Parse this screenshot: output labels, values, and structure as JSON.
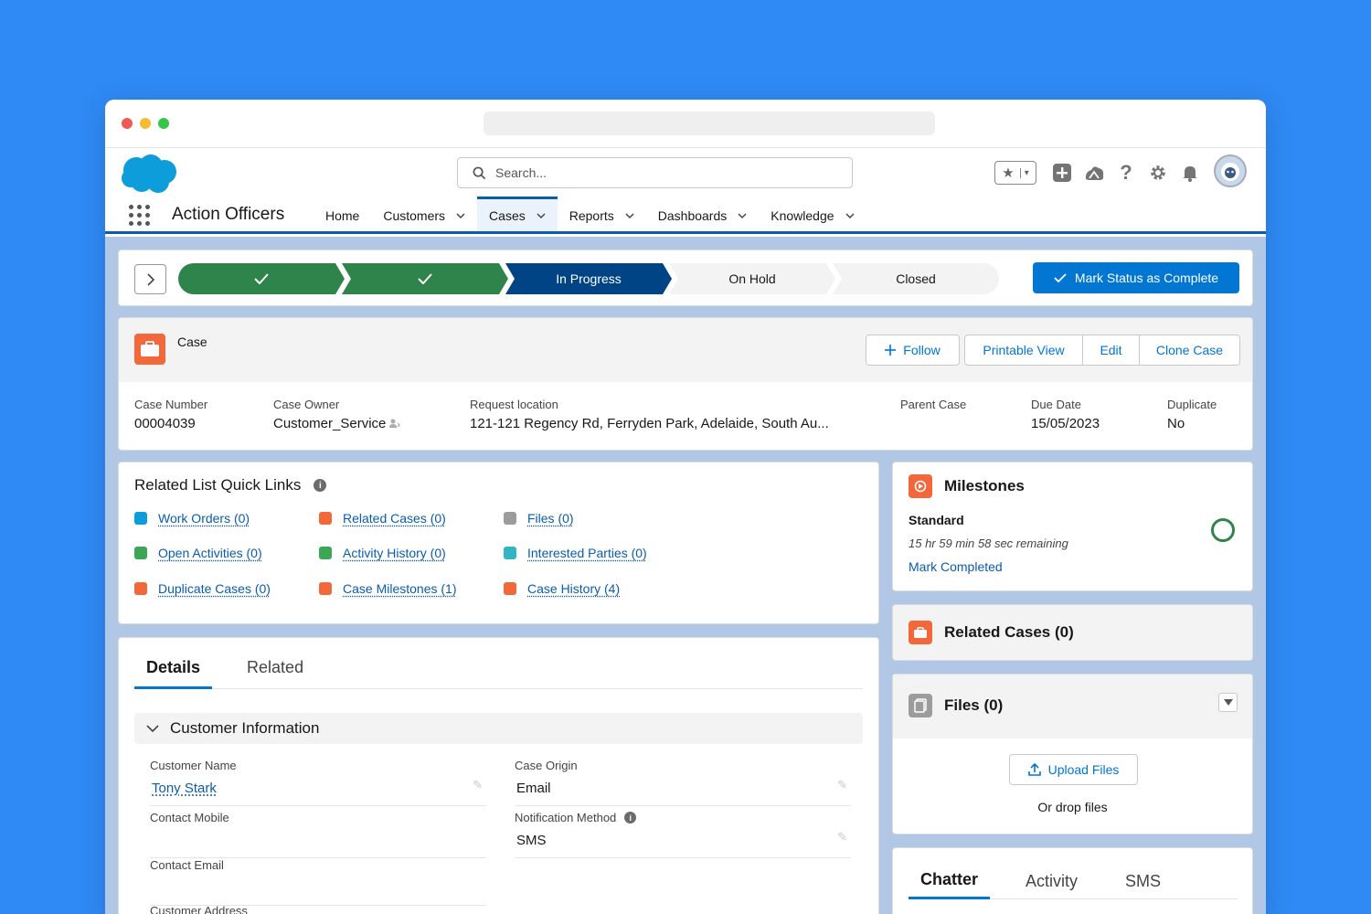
{
  "app": {
    "name": "Action Officers"
  },
  "search": {
    "placeholder": "Search..."
  },
  "nav": [
    {
      "label": "Home",
      "dropdown": false,
      "active": false
    },
    {
      "label": "Customers",
      "dropdown": true,
      "active": false
    },
    {
      "label": "Cases",
      "dropdown": true,
      "active": true
    },
    {
      "label": "Reports",
      "dropdown": true,
      "active": false
    },
    {
      "label": "Dashboards",
      "dropdown": true,
      "active": false
    },
    {
      "label": "Knowledge",
      "dropdown": true,
      "active": false
    }
  ],
  "path": {
    "stages": [
      {
        "label": "",
        "status": "done"
      },
      {
        "label": "",
        "status": "done"
      },
      {
        "label": "In Progress",
        "status": "current"
      },
      {
        "label": "On Hold",
        "status": "todo"
      },
      {
        "label": "Closed",
        "status": "todo"
      }
    ],
    "mark_button": "Mark Status as Complete"
  },
  "case": {
    "object_label": "Case",
    "buttons": {
      "follow": "Follow",
      "printable": "Printable View",
      "edit": "Edit",
      "clone": "Clone Case"
    },
    "fields": [
      {
        "label": "Case Number",
        "value": "00004039"
      },
      {
        "label": "Case Owner",
        "value": "Customer_Service"
      },
      {
        "label": "Request location",
        "value": "121-121 Regency Rd, Ferryden Park, Adelaide, South Au..."
      },
      {
        "label": "Parent Case",
        "value": ""
      },
      {
        "label": "Due Date",
        "value": "15/05/2023"
      },
      {
        "label": "Duplicate",
        "value": "No"
      }
    ]
  },
  "quick_links": {
    "title": "Related List Quick Links",
    "links": [
      {
        "label": "Work Orders (0)",
        "color": "#0d9dda"
      },
      {
        "label": "Related Cases (0)",
        "color": "#f2683a"
      },
      {
        "label": "Files (0)",
        "color": "#9c9c9c"
      },
      {
        "label": "Open Activities (0)",
        "color": "#3ba755"
      },
      {
        "label": "Activity History (0)",
        "color": "#3ba755"
      },
      {
        "label": "Interested Parties (0)",
        "color": "#31b5c4"
      },
      {
        "label": "Duplicate Cases (0)",
        "color": "#f2683a"
      },
      {
        "label": "Case Milestones (1)",
        "color": "#f2683a"
      },
      {
        "label": "Case History (4)",
        "color": "#f2683a"
      }
    ]
  },
  "details": {
    "tabs": [
      "Details",
      "Related"
    ],
    "section": "Customer Information",
    "fields": [
      {
        "label": "Customer Name",
        "value": "Tony Stark",
        "link": true,
        "info": false
      },
      {
        "label": "Case Origin",
        "value": "Email",
        "link": false,
        "info": false
      },
      {
        "label": "Contact Mobile",
        "value": "",
        "link": false,
        "info": false
      },
      {
        "label": "Notification Method",
        "value": "SMS",
        "link": false,
        "info": true
      },
      {
        "label": "Contact Email",
        "value": "",
        "link": false,
        "info": false
      },
      {
        "label": "Customer Address",
        "value": "",
        "link": false,
        "info": false
      }
    ]
  },
  "milestones": {
    "title": "Milestones",
    "name": "Standard",
    "remaining": "15 hr 59 min 58 sec remaining",
    "action": "Mark Completed"
  },
  "related_cases": {
    "title": "Related Cases (0)"
  },
  "files": {
    "title": "Files (0)",
    "upload": "Upload Files",
    "drop": "Or drop files"
  },
  "chatter": {
    "tabs": [
      "Chatter",
      "Activity",
      "SMS"
    ]
  }
}
